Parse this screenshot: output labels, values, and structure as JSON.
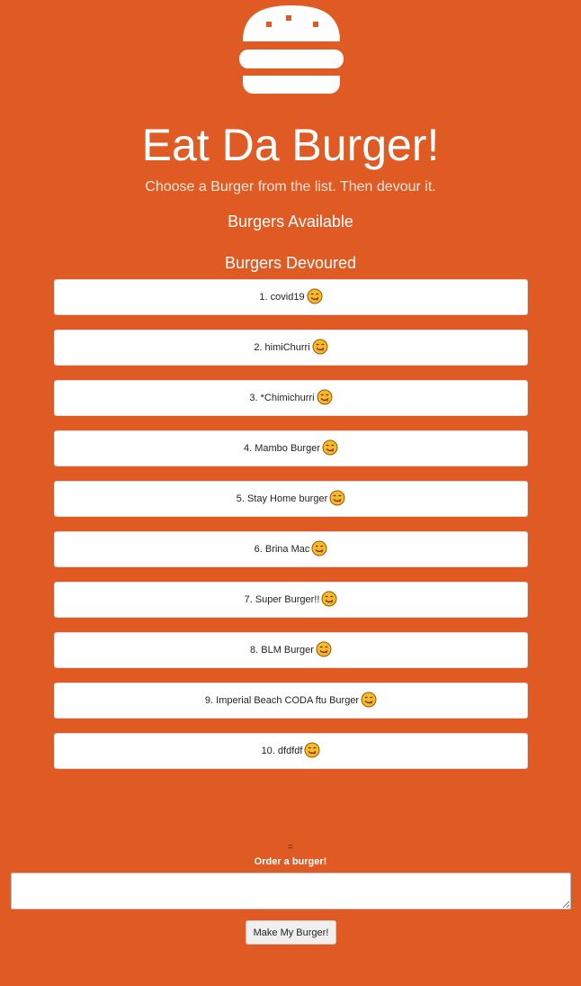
{
  "header": {
    "logo_icon": "hamburger-icon",
    "title": "Eat Da Burger!",
    "subtitle": "Choose a Burger from the list. Then devour it."
  },
  "sections": {
    "available_heading": "Burgers Available",
    "devoured_heading": "Burgers Devoured"
  },
  "devoured_burgers": [
    {
      "label": "1. covid19",
      "icon": "yum-face-emoji"
    },
    {
      "label": "2. himiChurri",
      "icon": "yum-face-emoji"
    },
    {
      "label": "3. *Chimichurri",
      "icon": "yum-face-emoji"
    },
    {
      "label": "4. Mambo Burger",
      "icon": "yum-face-emoji"
    },
    {
      "label": "5. Stay Home burger",
      "icon": "yum-face-emoji"
    },
    {
      "label": "6. Brina Mac",
      "icon": "yum-face-emoji"
    },
    {
      "label": "7. Super Burger!!",
      "icon": "yum-face-emoji"
    },
    {
      "label": "8. BLM Burger",
      "icon": "yum-face-emoji"
    },
    {
      "label": "9. Imperial Beach CODA ftu Burger",
      "icon": "yum-face-emoji"
    },
    {
      "label": "10. dfdfdf",
      "icon": "yum-face-emoji"
    }
  ],
  "order_form": {
    "divider": "=",
    "label": "Order a burger!",
    "input_value": "",
    "submit_label": "Make My Burger!"
  },
  "colors": {
    "background": "#e05a24",
    "card": "#ffffff",
    "text_light": "#ffffff",
    "emoji_face": "#f7b829"
  }
}
